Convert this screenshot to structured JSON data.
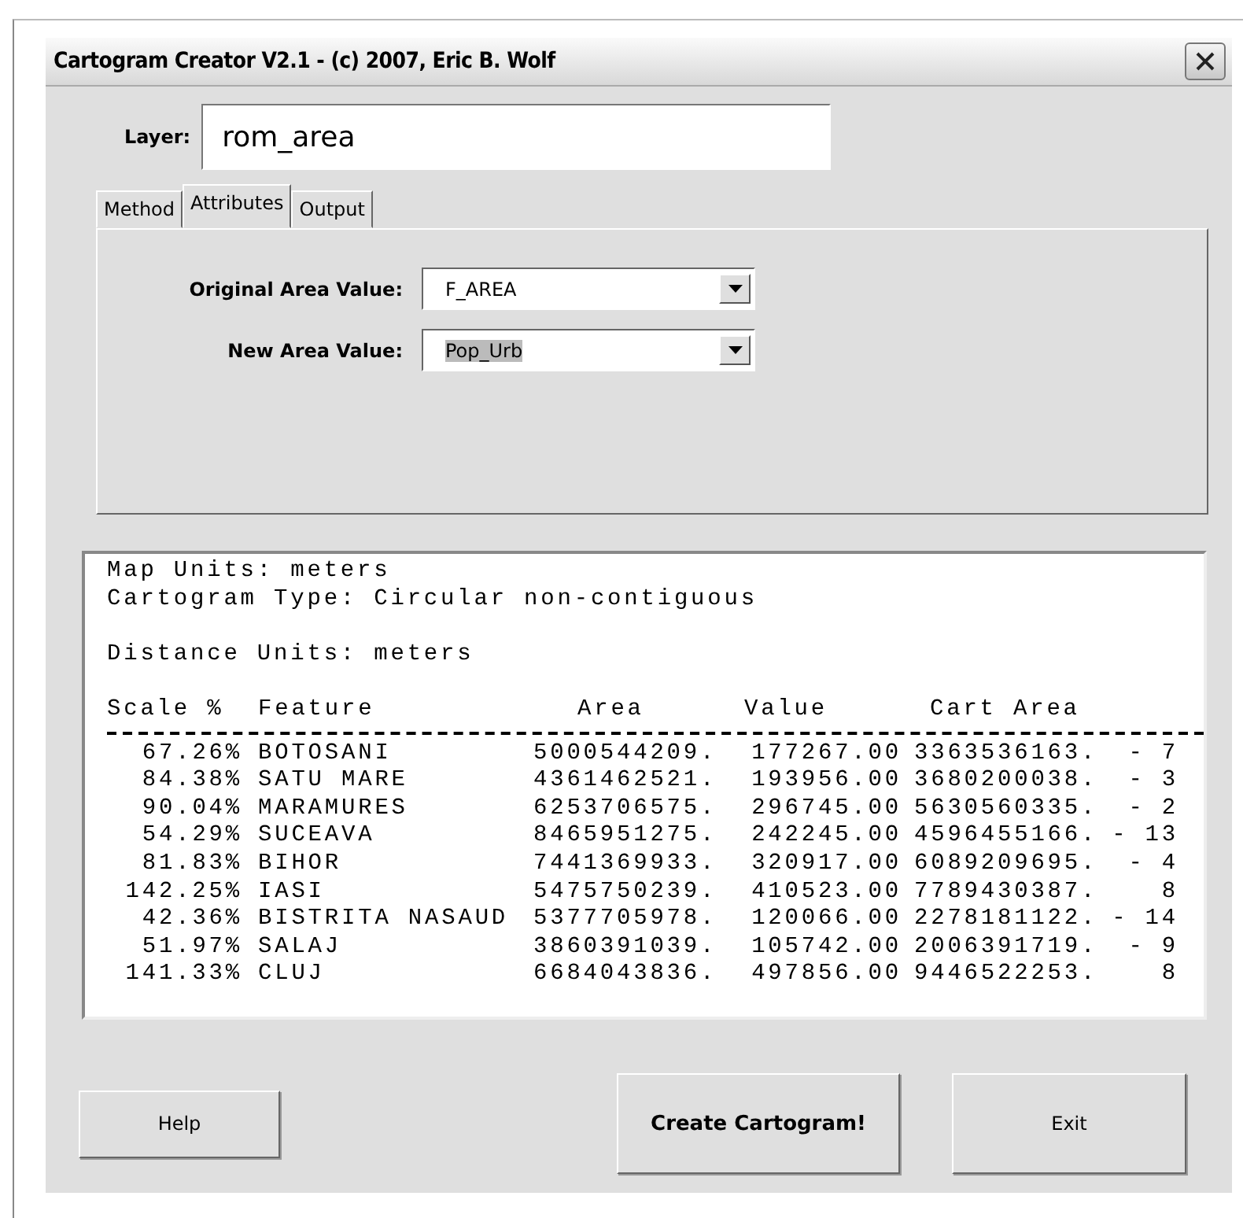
{
  "window": {
    "title": "Cartogram Creator V2.1 - (c) 2007, Eric B. Wolf"
  },
  "layer": {
    "label": "Layer:",
    "value": "rom_area"
  },
  "tabs": [
    {
      "label": "Method",
      "selected": false
    },
    {
      "label": "Attributes",
      "selected": true
    },
    {
      "label": "Output",
      "selected": false
    }
  ],
  "fields": [
    {
      "label": "Original Area Value:",
      "value": "F_AREA",
      "highlighted": false
    },
    {
      "label": "New Area Value:",
      "value": "Pop_Urb",
      "highlighted": true
    }
  ],
  "output": {
    "lines": [
      "Map Units: meters",
      "Cartogram Type: Circular non-contiguous"
    ],
    "distance_line": "Distance Units: meters",
    "columns": [
      "Scale %",
      "Feature",
      "Area",
      "Value",
      "Cart Area"
    ],
    "rows": [
      {
        "scale": "67.26%",
        "feature": "BOTOSANI",
        "area": "5000544209.",
        "value": "177267.00",
        "cart_area": "3363536163.",
        "rank": "- 7"
      },
      {
        "scale": "84.38%",
        "feature": "SATU MARE",
        "area": "4361462521.",
        "value": "193956.00",
        "cart_area": "3680200038.",
        "rank": "- 3"
      },
      {
        "scale": "90.04%",
        "feature": "MARAMURES",
        "area": "6253706575.",
        "value": "296745.00",
        "cart_area": "5630560335.",
        "rank": "- 2"
      },
      {
        "scale": "54.29%",
        "feature": "SUCEAVA",
        "area": "8465951275.",
        "value": "242245.00",
        "cart_area": "4596455166.",
        "rank": "- 13"
      },
      {
        "scale": "81.83%",
        "feature": "BIHOR",
        "area": "7441369933.",
        "value": "320917.00",
        "cart_area": "6089209695.",
        "rank": "- 4"
      },
      {
        "scale": "142.25%",
        "feature": "IASI",
        "area": "5475750239.",
        "value": "410523.00",
        "cart_area": "7789430387.",
        "rank": "8"
      },
      {
        "scale": "42.36%",
        "feature": "BISTRITA NASAUD",
        "area": "5377705978.",
        "value": "120066.00",
        "cart_area": "2278181122.",
        "rank": "- 14"
      },
      {
        "scale": "51.97%",
        "feature": "SALAJ",
        "area": "3860391039.",
        "value": "105742.00",
        "cart_area": "2006391719.",
        "rank": "- 9"
      },
      {
        "scale": "141.33%",
        "feature": "CLUJ",
        "area": "6684043836.",
        "value": "497856.00",
        "cart_area": "9446522253.",
        "rank": "8"
      }
    ]
  },
  "buttons": [
    {
      "label": "Help",
      "kind": "plain"
    },
    {
      "label": "Create Cartogram!",
      "kind": "primary"
    },
    {
      "label": "Exit",
      "kind": "plain"
    }
  ]
}
